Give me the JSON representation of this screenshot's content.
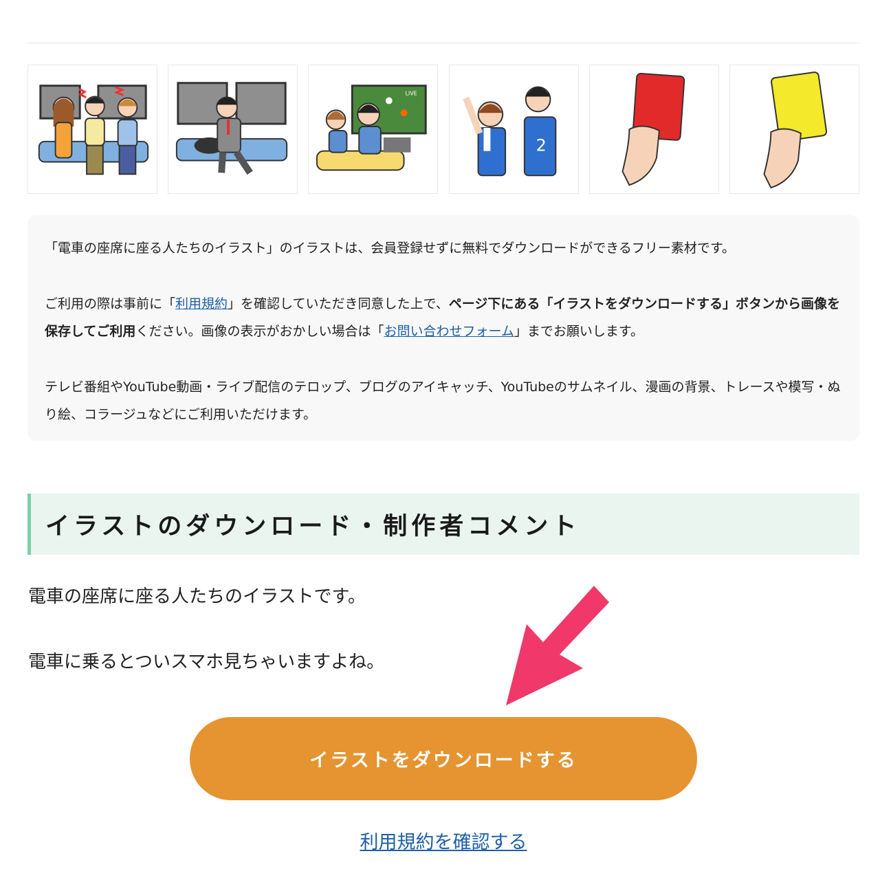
{
  "thumbnails": [
    {
      "icon": "train-passengers-sleeping-illustration"
    },
    {
      "icon": "businessman-sleeping-on-train-illustration"
    },
    {
      "icon": "family-watching-soccer-tv-illustration"
    },
    {
      "icon": "soccer-fans-cheering-illustration"
    },
    {
      "icon": "red-card-illustration",
      "color": "#e32a2a"
    },
    {
      "icon": "yellow-card-illustration",
      "color": "#f4e92a"
    }
  ],
  "description": {
    "p1": "「電車の座席に座る人たちのイラスト」のイラストは、会員登録せずに無料でダウンロードができるフリー素材です。",
    "p2_a": "ご利用の際は事前に「",
    "p2_link1": "利用規約",
    "p2_b": "」を確認していただき同意した上で、",
    "p2_bold": "ページ下にある「イラストをダウンロードする」ボタンから画像を保存してご利用",
    "p2_c": "ください。画像の表示がおかしい場合は「",
    "p2_link2": "お問い合わせフォーム",
    "p2_d": "」までお願いします。",
    "p3": "テレビ番組やYouTube動画・ライブ配信のテロップ、ブログのアイキャッチ、YouTubeのサムネイル、漫画の背景、トレースや模写・ぬり絵、コラージュなどにご利用いただけます。"
  },
  "section": {
    "heading": "イラストのダウンロード・制作者コメント",
    "comment1": "電車の座席に座る人たちのイラストです。",
    "comment2": "電車に乗るとついスマホ見ちゃいますよね。"
  },
  "download_button": "イラストをダウンロードする",
  "terms_link": "利用規約を確認する",
  "colors": {
    "button": "#e59431",
    "arrow": "#f0386b",
    "heading_bg": "#eaf5f0",
    "heading_accent": "#7ccfa8",
    "link": "#1d5fa6"
  }
}
